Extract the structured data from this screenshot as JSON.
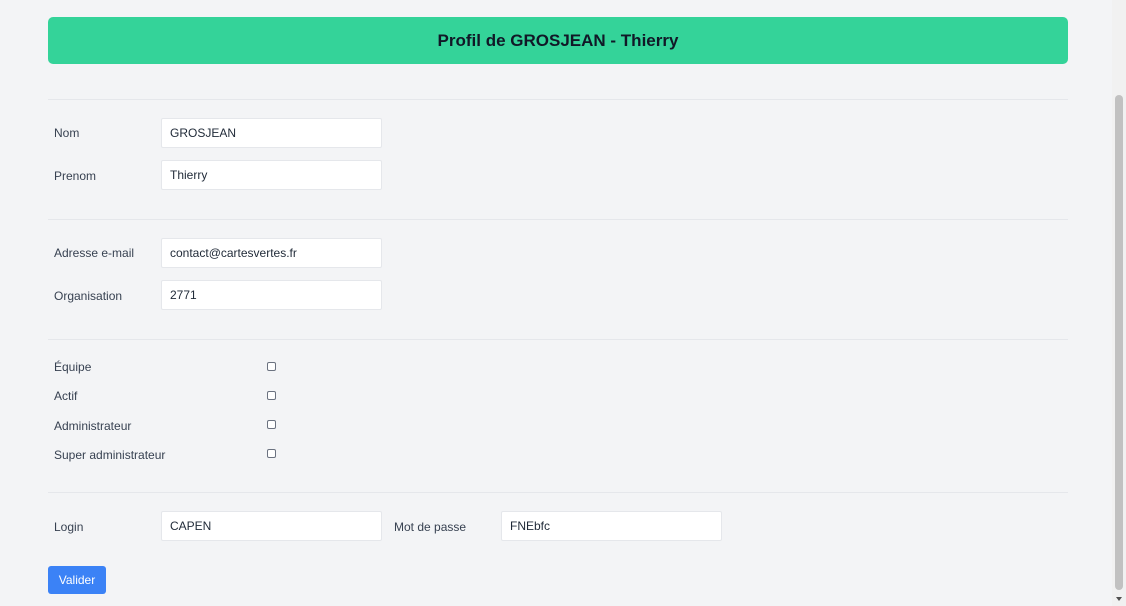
{
  "header": {
    "title": "Profil de GROSJEAN - Thierry"
  },
  "identity": {
    "nom_label": "Nom",
    "nom_value": "GROSJEAN",
    "prenom_label": "Prenom",
    "prenom_value": "Thierry"
  },
  "contact": {
    "email_label": "Adresse e-mail",
    "email_value": "contact@cartesvertes.fr",
    "org_label": "Organisation",
    "org_value": "2771"
  },
  "flags": {
    "equipe_label": "Équipe",
    "actif_label": "Actif",
    "admin_label": "Administrateur",
    "super_admin_label": "Super administrateur"
  },
  "credentials": {
    "login_label": "Login",
    "login_value": "CAPEN",
    "password_label": "Mot de passe",
    "password_value": "FNEbfc"
  },
  "actions": {
    "submit_label": "Valider"
  },
  "colors": {
    "banner": "#34d399",
    "button": "#3b82f6",
    "background": "#f3f4f6"
  }
}
